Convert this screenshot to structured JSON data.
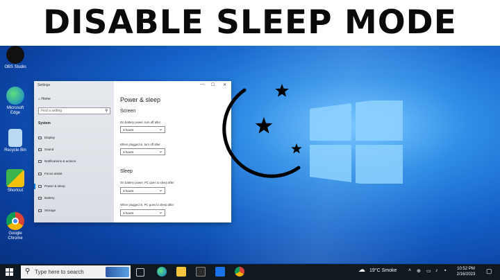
{
  "banner": {
    "title": "DISABLE SLEEP MODE"
  },
  "desktop_icons": [
    {
      "label": "OBS Studio",
      "color": "#111111"
    },
    {
      "label": "Microsoft Edge",
      "color": "#0f7bd1"
    },
    {
      "label": "Recycle Bin",
      "color": "#b9d8f2"
    },
    {
      "label": "Shortcut",
      "color": "#e8e8e8"
    },
    {
      "label": "Google Chrome",
      "color": "#ffffff"
    }
  ],
  "settings": {
    "window_title": "Settings",
    "home": "Home",
    "search_placeholder": "Find a setting",
    "section": "System",
    "nav": [
      "Display",
      "Sound",
      "Notifications & actions",
      "Focus assist",
      "Power & sleep",
      "Battery",
      "Storage"
    ],
    "active_nav": "Power & sleep",
    "page_title": "Power & sleep",
    "screen_heading": "Screen",
    "screen_battery_label": "On battery power, turn off after",
    "screen_battery_value": "3 hours",
    "screen_plugged_label": "When plugged in, turn off after",
    "screen_plugged_value": "3 hours",
    "sleep_heading": "Sleep",
    "sleep_battery_label": "On battery power, PC goes to sleep after",
    "sleep_battery_value": "3 hours",
    "sleep_plugged_label": "When plugged in, PC goes to sleep after",
    "sleep_plugged_value": "3 hours",
    "controls": {
      "minimize": "—",
      "maximize": "☐",
      "close": "✕"
    }
  },
  "taskbar": {
    "search_placeholder": "Type here to search",
    "weather": "19°C Smoke",
    "time": "10:52 PM",
    "date": "2/16/2023"
  },
  "colors": {
    "accent": "#0078d7",
    "banner_text": "#0a0a0a",
    "taskbar": "#101820"
  }
}
